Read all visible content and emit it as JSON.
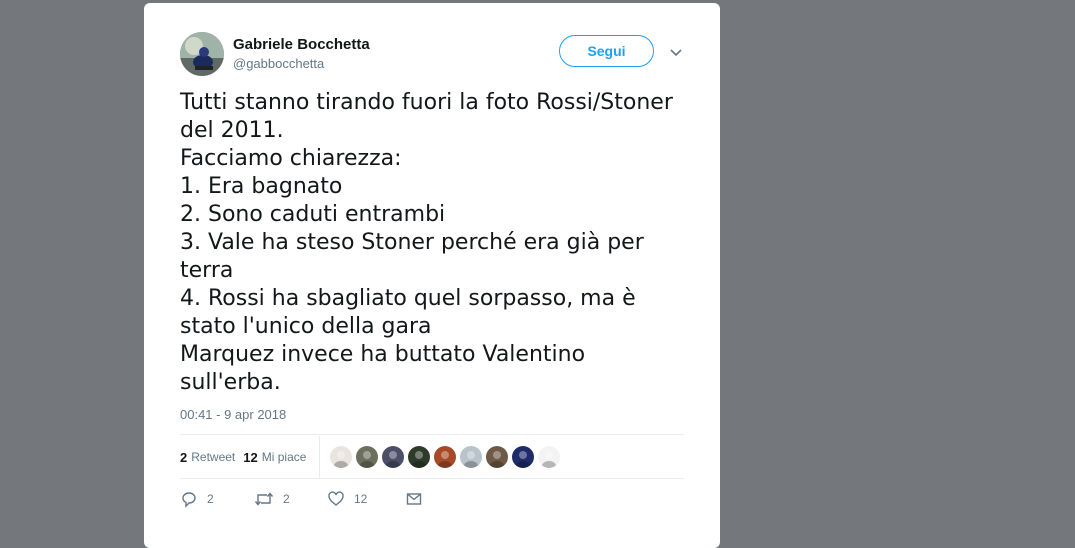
{
  "tweet": {
    "display_name": "Gabriele Bocchetta",
    "handle": "@gabbocchetta",
    "follow_label": "Segui",
    "text": "Tutti stanno tirando fuori la foto Rossi/Stoner\ndel 2011.\nFacciamo chiarezza:\n1. Era bagnato\n2. Sono caduti entrambi\n3. Vale ha steso Stoner perché era già per\nterra\n4. Rossi ha sbagliato quel sorpasso, ma è\nstato l'unico della gara\nMarquez invece ha buttato Valentino\nsull'erba.",
    "timestamp": "00:41 - 9 apr 2018"
  },
  "stats": {
    "retweet_count": "2",
    "retweet_label": "Retweet",
    "like_count": "12",
    "like_label": "Mi piace"
  },
  "liker_avatars": [
    {
      "name": "liker-avatar-1",
      "color": "#e9e4de"
    },
    {
      "name": "liker-avatar-2",
      "color": "#6b6f5c"
    },
    {
      "name": "liker-avatar-3",
      "color": "#4b4f68"
    },
    {
      "name": "liker-avatar-4",
      "color": "#2f3b2a"
    },
    {
      "name": "liker-avatar-5",
      "color": "#a84a2a"
    },
    {
      "name": "liker-avatar-6",
      "color": "#b9c3cb"
    },
    {
      "name": "liker-avatar-7",
      "color": "#6e5a46"
    },
    {
      "name": "liker-avatar-8",
      "color": "#1f2c6a"
    },
    {
      "name": "liker-avatar-9",
      "color": "#f3f3f3"
    }
  ],
  "actions": {
    "reply_count": "2",
    "retweet_count": "2",
    "like_count": "12"
  },
  "colors": {
    "accent": "#1da1f2",
    "secondary_text": "#657786",
    "background": "#74787c"
  }
}
